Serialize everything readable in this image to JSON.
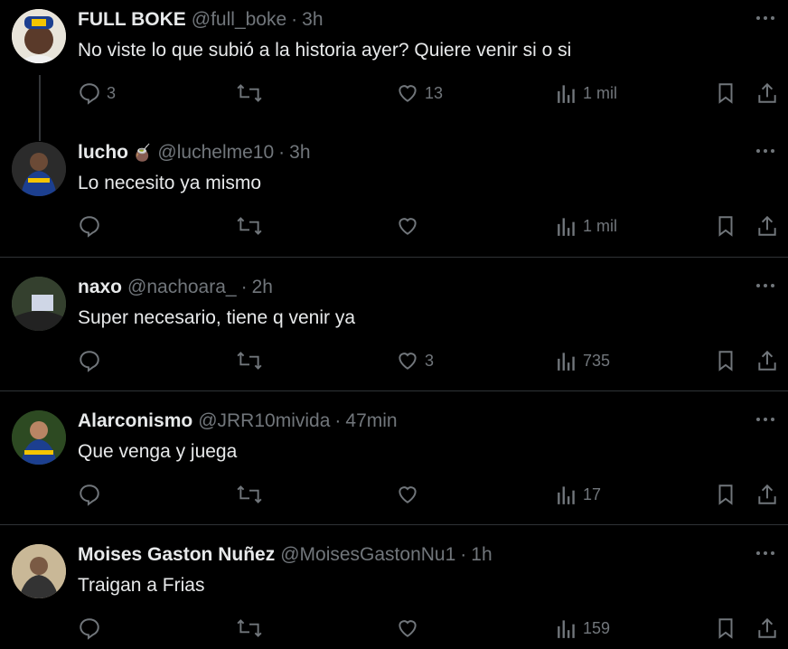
{
  "tweets": [
    {
      "name": "FULL BOKE",
      "handle": "@full_boke",
      "time": "3h",
      "emoji": "",
      "text": "No viste lo que subió a la historia ayer? Quiere venir si o si",
      "replies": "3",
      "retweets": "",
      "likes": "13",
      "views": "1 mil"
    },
    {
      "name": "lucho",
      "handle": "@luchelme10",
      "time": "3h",
      "emoji": "🧉",
      "text": "Lo necesito ya mismo",
      "replies": "",
      "retweets": "",
      "likes": "",
      "views": "1 mil"
    },
    {
      "name": "naxo",
      "handle": "@nachoara_",
      "time": "2h",
      "emoji": "",
      "text": "Super necesario, tiene q venir ya",
      "replies": "",
      "retweets": "",
      "likes": "3",
      "views": "735"
    },
    {
      "name": "Alarconismo",
      "handle": "@JRR10mivida",
      "time": "47min",
      "emoji": "",
      "text": "Que venga y juega",
      "replies": "",
      "retweets": "",
      "likes": "",
      "views": "17"
    },
    {
      "name": "Moises Gaston Nuñez",
      "handle": "@MoisesGastonNu1",
      "time": "1h",
      "emoji": "",
      "text": "Traigan a Frias",
      "replies": "",
      "retweets": "",
      "likes": "",
      "views": "159"
    }
  ],
  "separator": "·",
  "colors": {
    "background": "#000000",
    "text": "#e7e9ea",
    "muted": "#71767b",
    "divider": "#2f3336"
  }
}
